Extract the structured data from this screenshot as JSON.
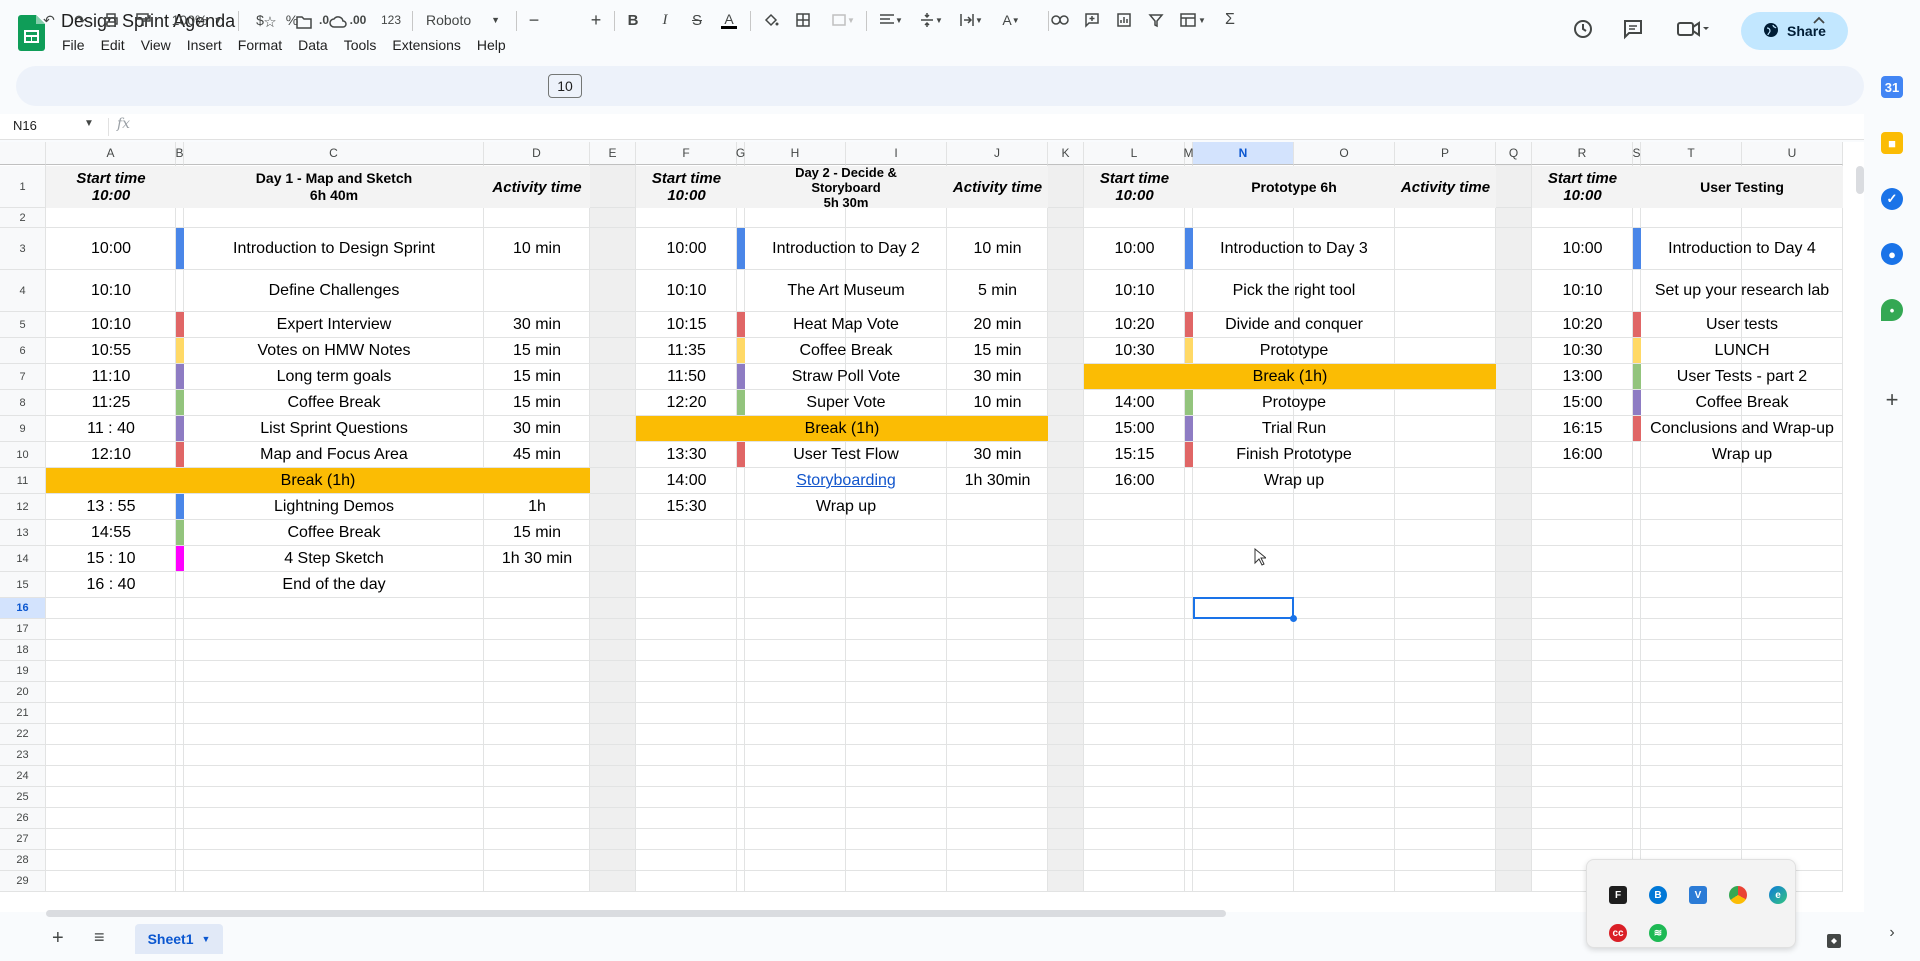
{
  "app": {
    "doc_title": "Design Sprint Agenda",
    "share_label": "Share"
  },
  "menu": [
    "File",
    "Edit",
    "View",
    "Insert",
    "Format",
    "Data",
    "Tools",
    "Extensions",
    "Help"
  ],
  "toolbar": {
    "zoom": "100%",
    "currency": "$",
    "percent": "%",
    "dec_less": ".0",
    "dec_more": ".00",
    "number_format": "123",
    "font": "Roboto",
    "font_size": "10"
  },
  "formula_bar": {
    "name_box": "N16",
    "fx": "fx"
  },
  "columns": [
    "A",
    "B",
    "C",
    "D",
    "E",
    "F",
    "G",
    "H",
    "I",
    "J",
    "K",
    "L",
    "M",
    "N",
    "O",
    "P",
    "Q",
    "R",
    "S",
    "T",
    "U"
  ],
  "rows": [
    "1",
    "2",
    "3",
    "4",
    "5",
    "6",
    "7",
    "8",
    "9",
    "10",
    "11",
    "12",
    "13",
    "14",
    "15",
    "16",
    "17",
    "18",
    "19",
    "20",
    "21",
    "22",
    "23",
    "24",
    "25",
    "26",
    "27",
    "28",
    "29"
  ],
  "colors": {
    "blue": "#4a86e8",
    "red": "#e06666",
    "yellow": "#ffd966",
    "purple": "#8e7cc3",
    "green": "#93c47d",
    "magenta": "#ff00ff",
    "break_orange": "#fbbc04",
    "header_gray": "#f3f3f3",
    "selection": "#1a73e8"
  },
  "day1": {
    "header": {
      "start": "Start time\n10:00",
      "title": "Day 1 - Map and Sketch\n6h 40m",
      "activity": "Activity time"
    },
    "rows": [
      {
        "time": "10:00",
        "activity": "Introduction to Design Sprint",
        "duration": "10 min",
        "color": "blue"
      },
      {
        "time": "10:10",
        "activity": "Define Challenges",
        "duration": "",
        "color": ""
      },
      {
        "time": "10:10",
        "activity": "Expert Interview",
        "duration": "30 min",
        "color": "red"
      },
      {
        "time": "10:55",
        "activity": "Votes on HMW Notes",
        "duration": "15 min",
        "color": "yellow"
      },
      {
        "time": "11:10",
        "activity": "Long term goals",
        "duration": "15 min",
        "color": "purple"
      },
      {
        "time": "11:25",
        "activity": "Coffee Break",
        "duration": "15 min",
        "color": "green"
      },
      {
        "time": "11 : 40",
        "activity": "List Sprint Questions",
        "duration": "30 min",
        "color": "purple"
      },
      {
        "time": "12:10",
        "activity": "Map and Focus Area",
        "duration": "45 min",
        "color": "red"
      },
      {
        "break": "Break (1h)"
      },
      {
        "time": "13 : 55",
        "activity": "Lightning Demos",
        "duration": "1h",
        "color": "blue"
      },
      {
        "time": "14:55",
        "activity": "Coffee Break",
        "duration": "15 min",
        "color": "green"
      },
      {
        "time": "15 : 10",
        "activity": "4 Step Sketch",
        "duration": "1h 30 min",
        "color": "magenta"
      },
      {
        "time": "16 : 40",
        "activity": "End of the day",
        "duration": "",
        "color": ""
      }
    ]
  },
  "day2": {
    "header": {
      "start": "Start time\n10:00",
      "title": "Day 2 - Decide &\nStoryboard\n5h 30m",
      "activity": "Activity time"
    },
    "rows": [
      {
        "time": "10:00",
        "activity": "Introduction to Day 2",
        "duration": "10 min",
        "color": "blue"
      },
      {
        "time": "10:10",
        "activity": "The Art Museum",
        "duration": "5 min",
        "color": ""
      },
      {
        "time": "10:15",
        "activity": "Heat Map Vote",
        "duration": "20 min",
        "color": "red"
      },
      {
        "time": "11:35",
        "activity": "Coffee Break",
        "duration": "15 min",
        "color": "yellow"
      },
      {
        "time": "11:50",
        "activity": "Straw Poll Vote",
        "duration": "30 min",
        "color": "purple"
      },
      {
        "time": "12:20",
        "activity": "Super Vote",
        "duration": "10 min",
        "color": "green"
      },
      {
        "break": "Break (1h)"
      },
      {
        "time": "13:30",
        "activity": "User Test Flow",
        "duration": "30 min",
        "color": "red"
      },
      {
        "time": "14:00",
        "activity": "Storyboarding",
        "duration": "1h 30min",
        "color": "",
        "link": true
      },
      {
        "time": "15:30",
        "activity": "Wrap up",
        "duration": "",
        "color": ""
      }
    ]
  },
  "day3": {
    "header": {
      "start": "Start time\n10:00",
      "title": "Prototype 6h",
      "activity": "Activity time"
    },
    "rows": [
      {
        "time": "10:00",
        "activity": "Introduction to Day 3",
        "color": "blue"
      },
      {
        "time": "10:10",
        "activity": "Pick the right tool",
        "color": ""
      },
      {
        "time": "10:20",
        "activity": "Divide and conquer",
        "color": "red"
      },
      {
        "time": "10:30",
        "activity": "Prototype",
        "color": "yellow"
      },
      {
        "break": "Break (1h)"
      },
      {
        "time": "14:00",
        "activity": "Protoype",
        "color": "green"
      },
      {
        "time": "15:00",
        "activity": "Trial Run",
        "color": "purple"
      },
      {
        "time": "15:15",
        "activity": "Finish Prototype",
        "color": "red"
      },
      {
        "time": "16:00",
        "activity": "Wrap up",
        "color": ""
      }
    ]
  },
  "day4": {
    "header": {
      "start": "Start time\n10:00",
      "title": "User Testing"
    },
    "rows": [
      {
        "time": "10:00",
        "activity": "Introduction to Day 4",
        "color": "blue"
      },
      {
        "time": "10:10",
        "activity": "Set up your research lab",
        "color": ""
      },
      {
        "time": "10:20",
        "activity": "User tests",
        "color": "red"
      },
      {
        "time": "10:30",
        "activity": "LUNCH",
        "color": "yellow"
      },
      {
        "time": "13:00",
        "activity": "User Tests - part 2",
        "color": "green"
      },
      {
        "time": "15:00",
        "activity": "Coffee Break",
        "color": "purple"
      },
      {
        "time": "16:15",
        "activity": "Conclusions and Wrap-up",
        "color": "red"
      },
      {
        "time": "16:00",
        "activity": "Wrap up",
        "color": ""
      }
    ]
  },
  "bottom": {
    "sheet_name": "Sheet1"
  },
  "side_panel": [
    "calendar-icon",
    "keep-icon",
    "tasks-icon",
    "contacts-icon",
    "maps-icon",
    "add-icon"
  ],
  "tray_icons": [
    "figma-icon",
    "bluetooth-icon",
    "vpn-icon",
    "chrome-icon",
    "edge-icon",
    "cc-icon",
    "spotify-icon"
  ]
}
